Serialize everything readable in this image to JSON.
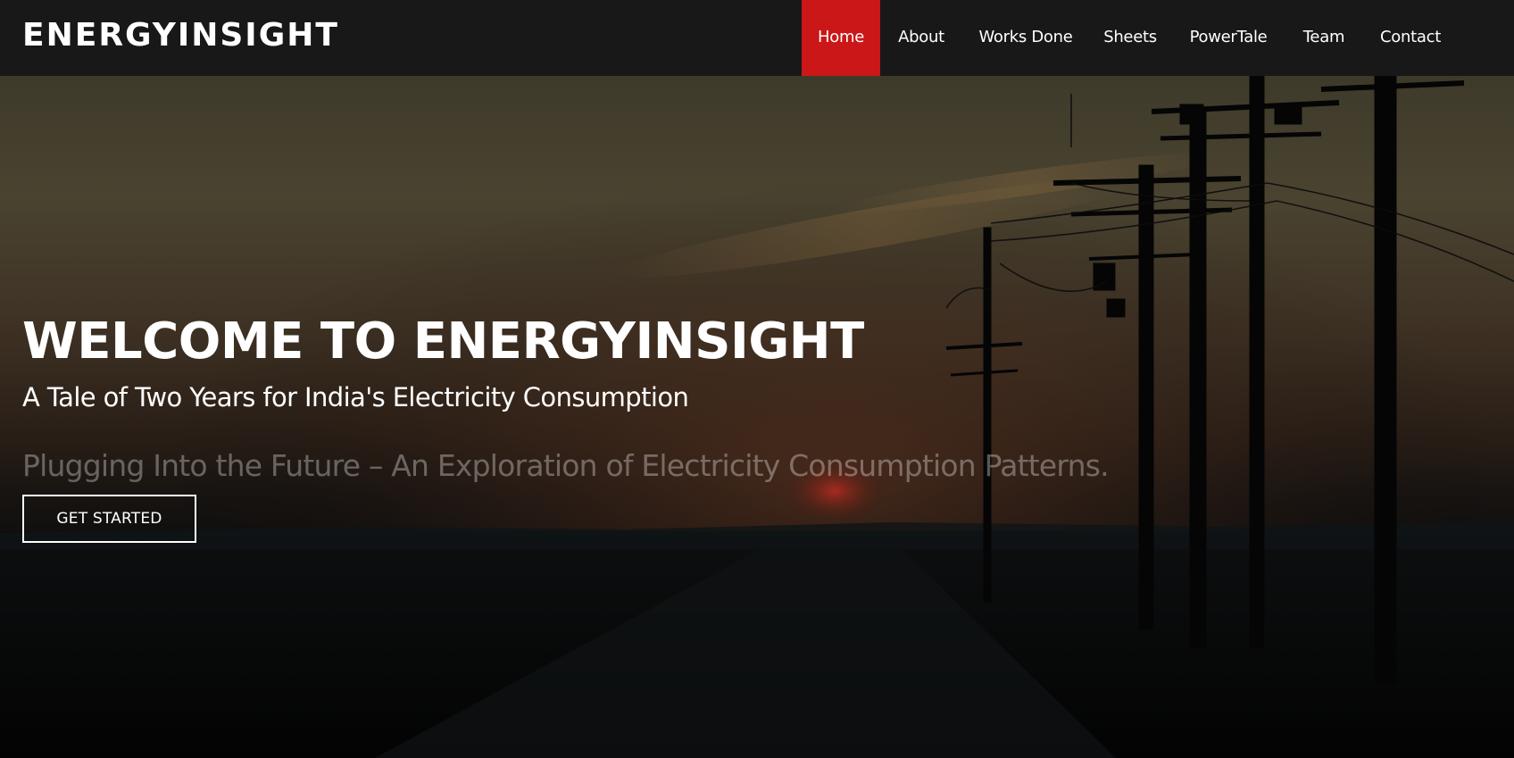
{
  "brand": {
    "name": "ENERGYINSIGHT"
  },
  "nav": {
    "items": [
      {
        "label": "Home",
        "active": true
      },
      {
        "label": "About",
        "active": false
      },
      {
        "label": "Works Done",
        "active": false
      },
      {
        "label": "Sheets",
        "active": false
      },
      {
        "label": "PowerTale",
        "active": false
      },
      {
        "label": "Team",
        "active": false
      },
      {
        "label": "Contact",
        "active": false
      }
    ]
  },
  "hero": {
    "title": "WELCOME TO ENERGYINSIGHT",
    "subtitle": "A Tale of Two Years for India's Electricity Consumption",
    "tagline": "Plugging Into the Future – An Exploration of Electricity Consumption Patterns.",
    "cta_label": "GET STARTED",
    "background_image": "sunset-power-lines"
  },
  "colors": {
    "header_bg": "#181818",
    "accent": "#cb1717",
    "text": "#ffffff"
  }
}
